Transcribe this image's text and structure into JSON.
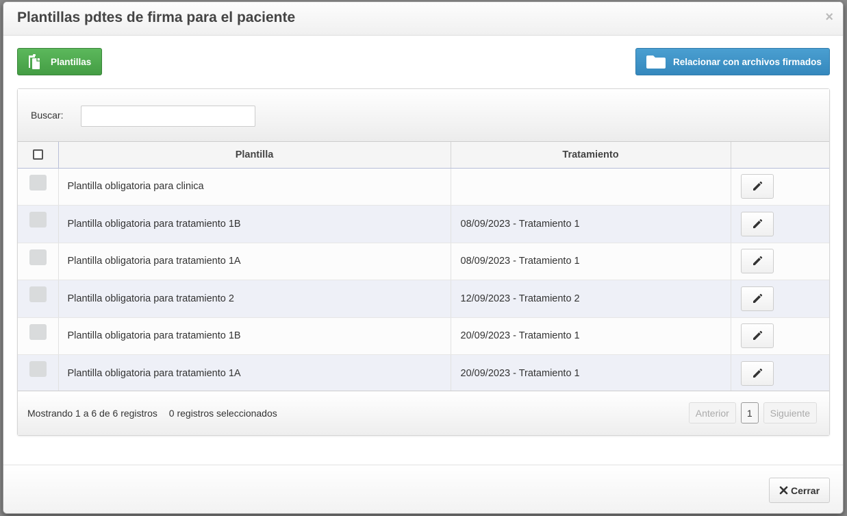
{
  "modal": {
    "title": "Plantillas pdtes de firma para el paciente",
    "close_symbol": "×"
  },
  "toolbar": {
    "plantillas_label": "Plantillas",
    "plantillas_icon": "copy-documents-icon",
    "relacionar_label": "Relacionar con archivos firmados",
    "relacionar_icon": "folder-icon"
  },
  "search": {
    "label": "Buscar:",
    "value": "",
    "placeholder": ""
  },
  "table": {
    "headers": [
      "",
      "Plantilla",
      "Tratamiento",
      ""
    ],
    "rows": [
      {
        "plantilla": "Plantilla obligatoria para clinica",
        "tratamiento": ""
      },
      {
        "plantilla": "Plantilla obligatoria para tratamiento 1B",
        "tratamiento": "08/09/2023 - Tratamiento 1"
      },
      {
        "plantilla": "Plantilla obligatoria para tratamiento 1A",
        "tratamiento": "08/09/2023 - Tratamiento 1"
      },
      {
        "plantilla": "Plantilla obligatoria para tratamiento 2",
        "tratamiento": "12/09/2023 - Tratamiento 2"
      },
      {
        "plantilla": "Plantilla obligatoria para tratamiento 1B",
        "tratamiento": "20/09/2023 - Tratamiento 1"
      },
      {
        "plantilla": "Plantilla obligatoria para tratamiento 1A",
        "tratamiento": "20/09/2023 - Tratamiento 1"
      }
    ],
    "row_action_icon": "pencil-icon"
  },
  "footer_info": {
    "showing": "Mostrando 1 a 6 de 6 registros",
    "selected": "0 registros seleccionados"
  },
  "pagination": {
    "previous": "Anterior",
    "current_page": "1",
    "next": "Siguiente"
  },
  "modal_footer": {
    "close_label": "Cerrar",
    "close_icon": "x-icon"
  },
  "colors": {
    "success": "#4cae4c",
    "primary": "#3b8fc6",
    "row_alt": "#eef0f7"
  }
}
